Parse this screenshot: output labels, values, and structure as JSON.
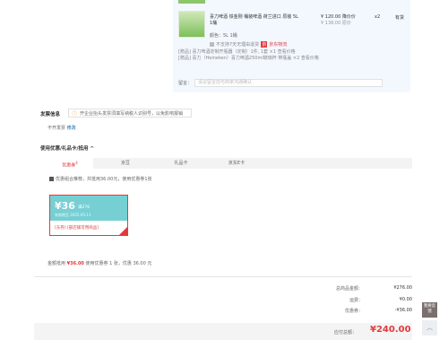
{
  "product": {
    "name": "喜力啤酒 铁金刚 桶装啤酒 荷兰进口 原装 5L 1桶",
    "color": "颜色：5L 1桶",
    "promo_text": "不支持7天无理由退货",
    "promo_tag": "京",
    "promo_red": "京东物流",
    "gift_lines": [
      "[赠品] 喜力啤酒定制开瓶器（定制）1件, 1套 ×1 查看价格",
      "[赠品] 喜力（Heineken）喜力啤酒250ml玻璃杯 带瓶盖 ×2 查看价格"
    ],
    "price": "¥ 120.00 降价价",
    "orig_price": "¥ 138.00 原价",
    "qty": "x2",
    "stock": "有货",
    "note_label": "留言：",
    "note_placeholder": "请议留言前与商家沟通确认"
  },
  "invoice": {
    "title": "发票信息",
    "notice": "开企业抬头发票须填写纳税人识别号，以免影响报销",
    "status": "不开发票",
    "modify": "修改"
  },
  "coupons": {
    "title": "使用优惠/礼品卡/抵用 ^",
    "tabs": [
      "优惠券",
      "京豆",
      "礼品卡",
      "京东E卡"
    ],
    "tab_badge": "4",
    "check_text": "优惠组合推荐，共抵用36.00元，使用优惠券1张",
    "card": {
      "amount": "¥36",
      "condition": "满276",
      "expiry": "有效期至 2025-05-11",
      "scope": "[东券] [部店铺可用商品]"
    },
    "discount_line_prefix": "金额抵用",
    "discount_amount": "¥36.00",
    "discount_line_suffix": "使用优惠券 1 张，优惠 36.00 元"
  },
  "summary": {
    "rows": [
      {
        "label": "总商品金额：",
        "value": "¥276.00"
      },
      {
        "label": "运费：",
        "value": "¥0.00"
      },
      {
        "label": "优惠券：",
        "value": "-¥36.00"
      }
    ],
    "total_label": "应付总额：",
    "total_value": "¥240.00"
  },
  "side": {
    "feedback": "我要反馈",
    "top_icon": "up-arrow-icon"
  },
  "colors": {
    "accent_red": "#e4393c",
    "coupon_teal": "#76cfd3",
    "link_blue": "#005aa0"
  }
}
